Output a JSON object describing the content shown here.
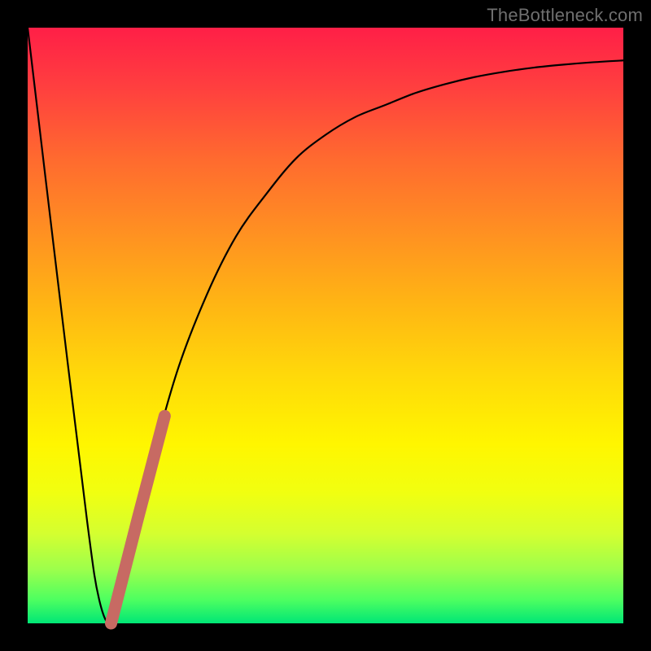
{
  "watermark": {
    "text": "TheBottleneck.com"
  },
  "chart_data": {
    "type": "line",
    "title": "",
    "xlabel": "",
    "ylabel": "",
    "xlim": [
      0,
      100
    ],
    "ylim": [
      0,
      100
    ],
    "series": [
      {
        "name": "bottleneck-curve",
        "x": [
          0,
          5,
          10,
          12,
          14,
          16,
          20,
          25,
          30,
          35,
          40,
          45,
          50,
          55,
          60,
          65,
          70,
          75,
          80,
          85,
          90,
          95,
          100
        ],
        "values": [
          100,
          58,
          17,
          4,
          0,
          7,
          24,
          42,
          55,
          65,
          72,
          78,
          82,
          85,
          87,
          89,
          90.5,
          91.7,
          92.6,
          93.3,
          93.8,
          94.2,
          94.5
        ]
      }
    ],
    "highlight_segment": {
      "name": "highlight-band",
      "x_start": 14,
      "x_end": 23,
      "color": "#c76a63"
    }
  }
}
